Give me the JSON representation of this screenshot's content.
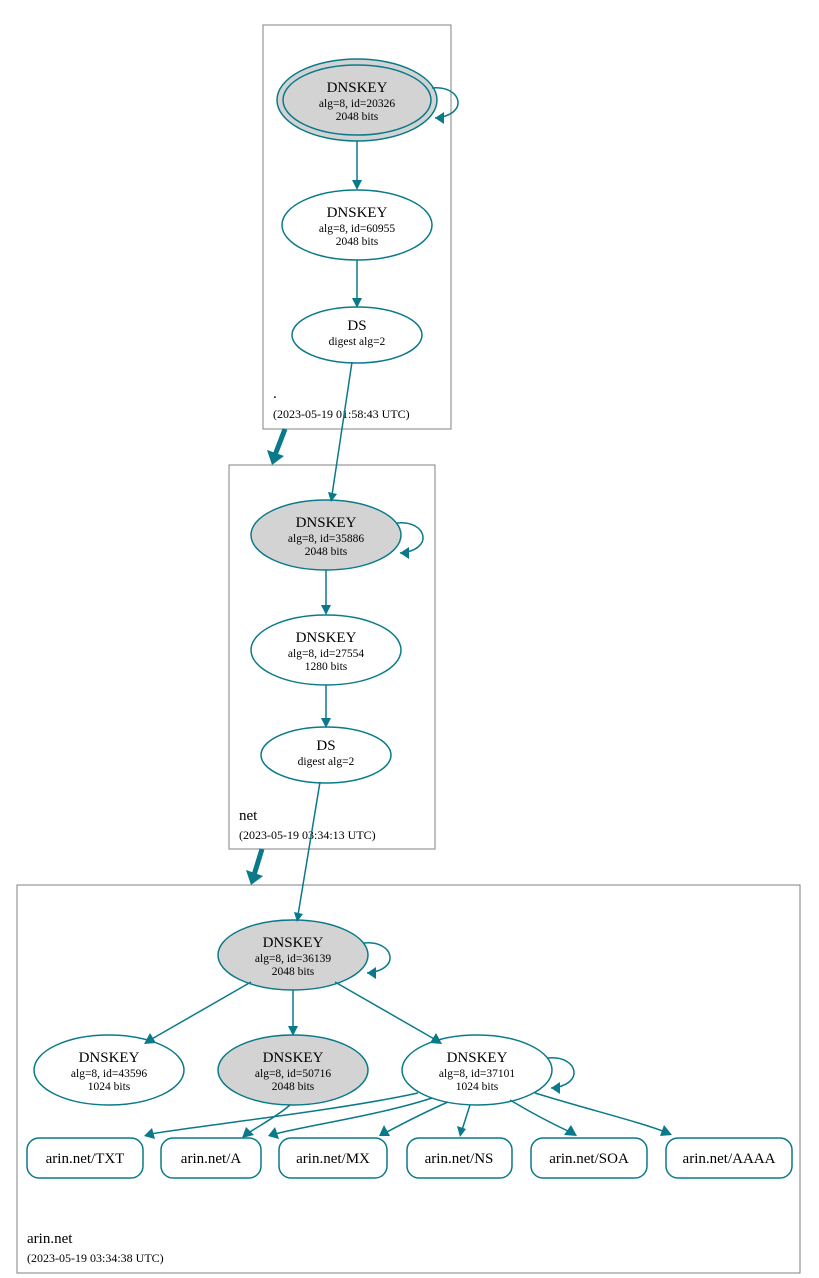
{
  "zones": {
    "root": {
      "label": ".",
      "timestamp": "(2023-05-19 01:58:43 UTC)",
      "ksk": {
        "title": "DNSKEY",
        "alg": "alg=8, id=20326",
        "bits": "2048 bits"
      },
      "zsk": {
        "title": "DNSKEY",
        "alg": "alg=8, id=60955",
        "bits": "2048 bits"
      },
      "ds": {
        "title": "DS",
        "alg": "digest alg=2"
      }
    },
    "net": {
      "label": "net",
      "timestamp": "(2023-05-19 03:34:13 UTC)",
      "ksk": {
        "title": "DNSKEY",
        "alg": "alg=8, id=35886",
        "bits": "2048 bits"
      },
      "zsk": {
        "title": "DNSKEY",
        "alg": "alg=8, id=27554",
        "bits": "1280 bits"
      },
      "ds": {
        "title": "DS",
        "alg": "digest alg=2"
      }
    },
    "arin": {
      "label": "arin.net",
      "timestamp": "(2023-05-19 03:34:38 UTC)",
      "ksk": {
        "title": "DNSKEY",
        "alg": "alg=8, id=36139",
        "bits": "2048 bits"
      },
      "k1": {
        "title": "DNSKEY",
        "alg": "alg=8, id=43596",
        "bits": "1024 bits"
      },
      "k2": {
        "title": "DNSKEY",
        "alg": "alg=8, id=50716",
        "bits": "2048 bits"
      },
      "k3": {
        "title": "DNSKEY",
        "alg": "alg=8, id=37101",
        "bits": "1024 bits"
      },
      "rr": {
        "txt": "arin.net/TXT",
        "a": "arin.net/A",
        "mx": "arin.net/MX",
        "ns": "arin.net/NS",
        "soa": "arin.net/SOA",
        "aaaa": "arin.net/AAAA"
      }
    }
  }
}
